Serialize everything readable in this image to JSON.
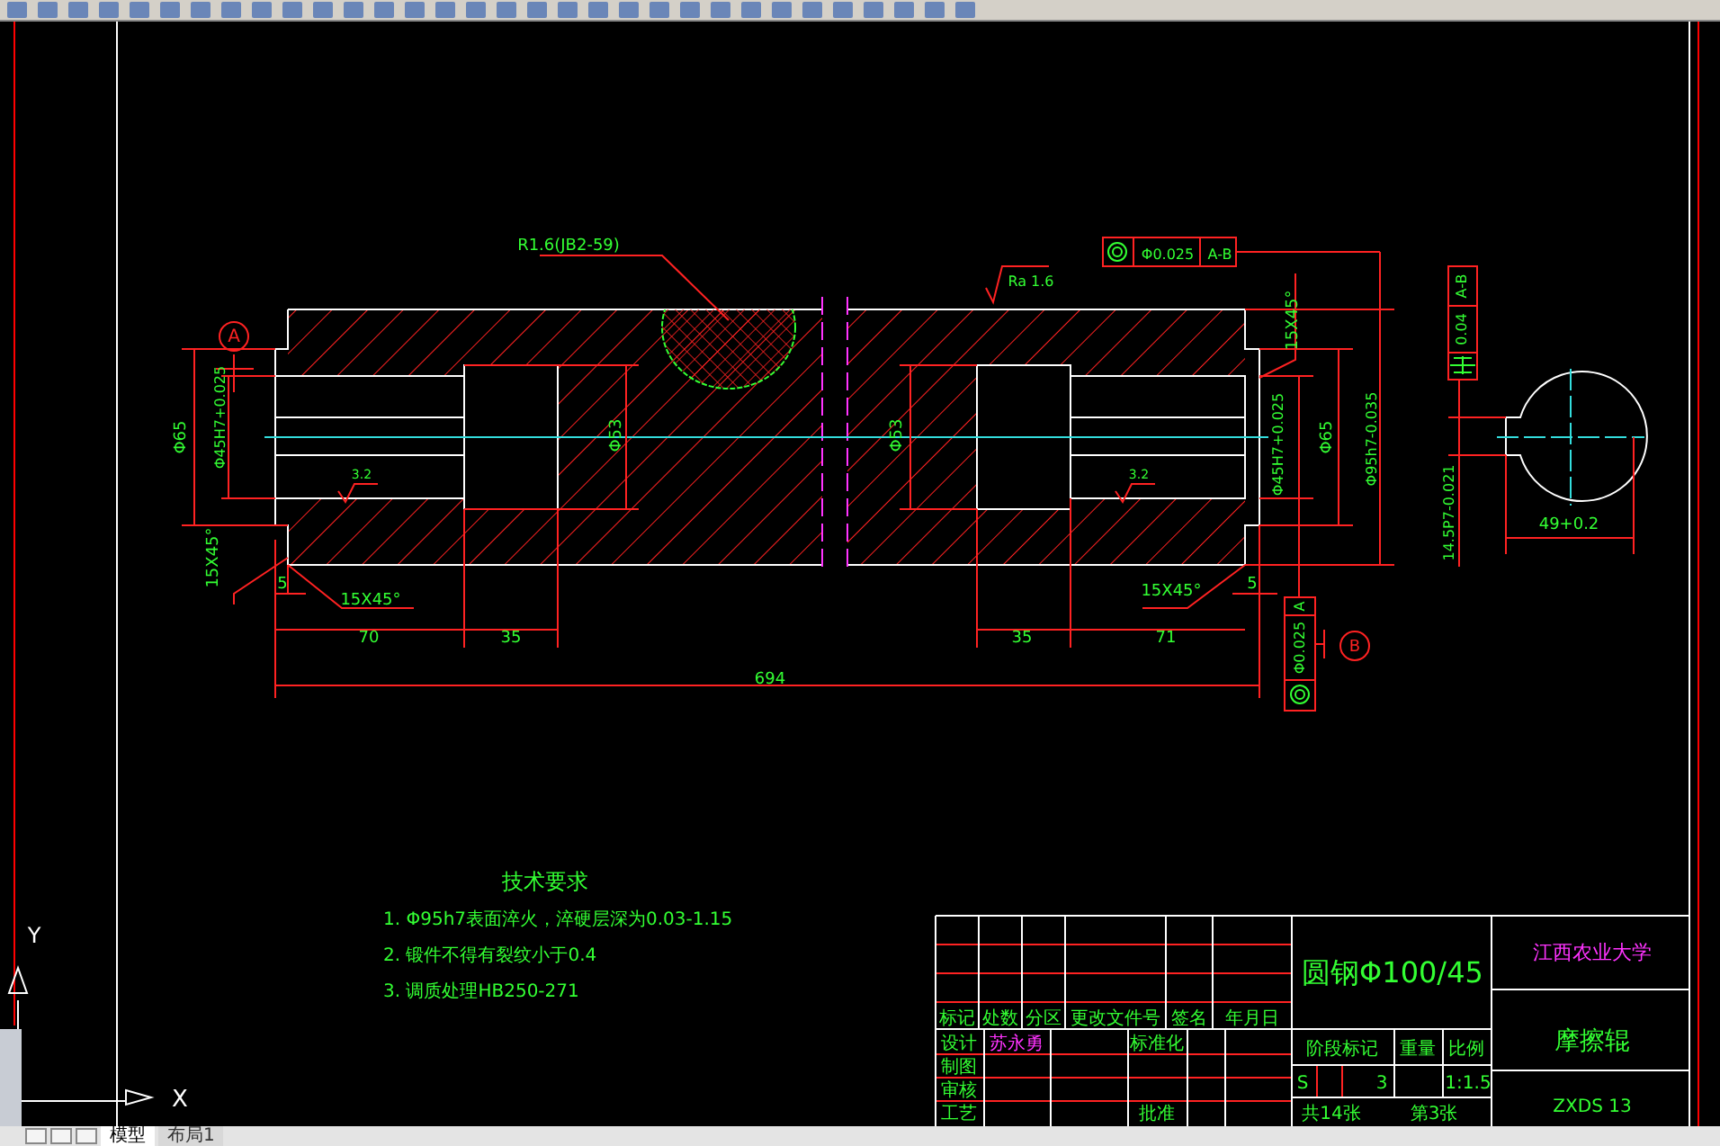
{
  "annotations": [
    {
      "text": "A",
      "kind": "datum"
    },
    {
      "text": "R1.6(JB2-59)",
      "kind": "note"
    },
    {
      "text": "Φ65",
      "kind": "dimension"
    },
    {
      "text": "Φ45H7+0.025",
      "kind": "dimension"
    },
    {
      "text": "Φ53",
      "kind": "dimension"
    },
    {
      "text": "15X45°",
      "kind": "dimension"
    },
    {
      "text": "5",
      "kind": "dimension"
    },
    {
      "text": "15X45°",
      "kind": "dimension"
    },
    {
      "text": "70",
      "kind": "dimension"
    },
    {
      "text": "35",
      "kind": "dimension"
    },
    {
      "text": "694",
      "kind": "dimension"
    },
    {
      "text": "3.2",
      "kind": "note"
    },
    {
      "text": "Ra 1.6",
      "kind": "note"
    },
    {
      "text": "Φ0.025",
      "kind": "tolerance"
    },
    {
      "text": "A-B",
      "kind": "tolerance"
    },
    {
      "text": "15X45°",
      "kind": "dimension"
    },
    {
      "text": "Φ53",
      "kind": "dimension"
    },
    {
      "text": "Φ45H7+0.025",
      "kind": "dimension"
    },
    {
      "text": "Φ65",
      "kind": "dimension"
    },
    {
      "text": "Φ95h7-0.035",
      "kind": "dimension"
    },
    {
      "text": "3.2",
      "kind": "note"
    },
    {
      "text": "15X45°",
      "kind": "dimension"
    },
    {
      "text": "5",
      "kind": "dimension"
    },
    {
      "text": "35",
      "kind": "dimension"
    },
    {
      "text": "71",
      "kind": "dimension"
    },
    {
      "text": "A",
      "kind": "tolerance"
    },
    {
      "text": "Φ0.025",
      "kind": "tolerance"
    },
    {
      "text": "B",
      "kind": "datum"
    },
    {
      "text": "A-B",
      "kind": "tolerance"
    },
    {
      "text": "0.04",
      "kind": "tolerance"
    },
    {
      "text": "14.5P7-0.021",
      "kind": "dimension"
    },
    {
      "text": "49+0.2",
      "kind": "dimension"
    }
  ],
  "requirements": {
    "heading": "技术要求",
    "lines": [
      "1. Φ95h7表面淬火，淬硬层深为0.03-1.15",
      "2. 锻件不得有裂纹小于0.4",
      "3. 调质处理HB250-271"
    ]
  },
  "title_block": [
    {
      "text": "标记",
      "kind": "label"
    },
    {
      "text": "处数",
      "kind": "label"
    },
    {
      "text": "分区",
      "kind": "label"
    },
    {
      "text": "更改文件号",
      "kind": "label"
    },
    {
      "text": "签名",
      "kind": "label"
    },
    {
      "text": "年月日",
      "kind": "label"
    },
    {
      "text": "设计",
      "kind": "label"
    },
    {
      "text": "苏永勇",
      "kind": "name"
    },
    {
      "text": "标准化",
      "kind": "label"
    },
    {
      "text": "制图",
      "kind": "label"
    },
    {
      "text": "审核",
      "kind": "label"
    },
    {
      "text": "工艺",
      "kind": "label"
    },
    {
      "text": "批准",
      "kind": "label"
    },
    {
      "text": "圆钢Φ100/45",
      "kind": "material"
    },
    {
      "text": "阶段标记",
      "kind": "label"
    },
    {
      "text": "重量",
      "kind": "label"
    },
    {
      "text": "比例",
      "kind": "label"
    },
    {
      "text": "S",
      "kind": "label"
    },
    {
      "text": "3",
      "kind": "label"
    },
    {
      "text": "1:1.5",
      "kind": "value"
    },
    {
      "text": "共14张",
      "kind": "label"
    },
    {
      "text": "第3张",
      "kind": "label"
    },
    {
      "text": "江西农业大学",
      "kind": "name"
    },
    {
      "text": "摩擦辊",
      "kind": "part"
    },
    {
      "text": "ZXDS 13",
      "kind": "label"
    }
  ],
  "ucs": {
    "y_label": "Y",
    "x_label": "X"
  },
  "layout_tabs": [
    {
      "label": "模型",
      "selected": true
    },
    {
      "label": "布局1",
      "selected": false
    }
  ]
}
